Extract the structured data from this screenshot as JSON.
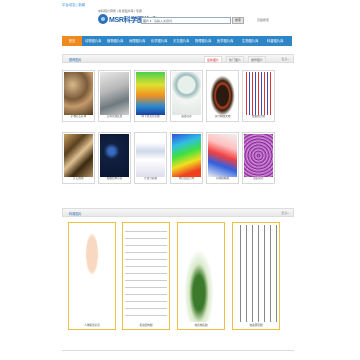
{
  "top": {
    "tag": "平台动态 | 新闻"
  },
  "header": {
    "logo_text": "MSR科学图片库",
    "logo_sub": "中科院计算所 | 科普图片库 | 专题",
    "search_category": "图片 ▾",
    "search_placeholder": "请输入关键词",
    "search_button": "搜索",
    "link": "高级搜索"
  },
  "nav": {
    "items": [
      "首页",
      "动物图片库",
      "植物图片库",
      "地理图片库",
      "化学图片库",
      "天文图片库",
      "物理图片库",
      "医学图片库",
      "生物图片库",
      "科普图片库"
    ]
  },
  "panel1": {
    "title": "推荐图片",
    "tabs": [
      "最新图片",
      "热门图片",
      "推荐图片"
    ],
    "more": "更多»",
    "items": [
      {
        "cap": "矿物岩石标本"
      },
      {
        "cap": "实验仪器装置"
      },
      {
        "cap": "地下管道示意图"
      },
      {
        "cap": "菌落培养"
      },
      {
        "cap": "古代陶器文物"
      },
      {
        "cap": "数据统计图"
      },
      {
        "cap": "矿石纹理"
      },
      {
        "cap": "细胞结构示意"
      },
      {
        "cap": "光谱分析图"
      },
      {
        "cap": "地形温度分布"
      },
      {
        "cap": "风场模拟图"
      },
      {
        "cap": "组织切片"
      }
    ]
  },
  "panel2": {
    "title": "科普图片",
    "more": "更多»",
    "items": [
      {
        "cap": "人体解剖示意"
      },
      {
        "cap": "机械结构图"
      },
      {
        "cap": "地质构造图"
      },
      {
        "cap": "电路原理图"
      }
    ]
  },
  "colors": {
    "nav_bg": "#2f86c6",
    "nav_active": "#f08a1e",
    "panel_title": "#2f6fb0"
  }
}
